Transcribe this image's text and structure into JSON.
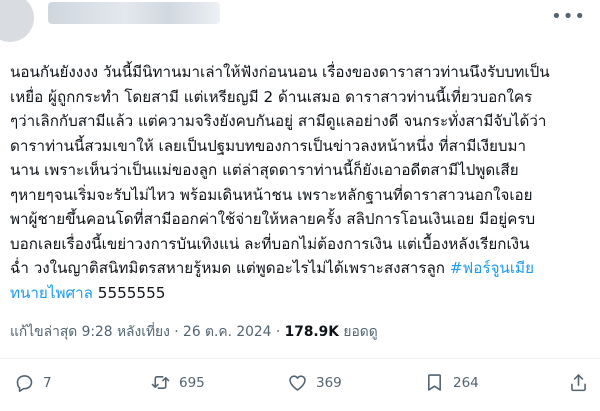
{
  "tweet": {
    "lines": [
      "นอนกันยังงงง วันนี้มีนิทานมาเล่าให้ฟังก่อนนอน เรื่องของดาราสาวท่านนึงรับบทเป็น",
      "เหยื่อ ผู้ถูกกระทำ โดยสามี แต่เหรียญมี 2 ด้านเสมอ ดาราสาวท่านนี้เที่ยวบอกใคร",
      "ๆว่าเลิกกับสามีแล้ว แต่ความจริงยังคบกันอยู่ สามีดูแลอย่างดี จนกระทั่งสามีจับได้ว่า",
      "ดาราท่านนี้สวมเขาให้ เลยเป็นปฐมบทของการเป็นข่าวลงหน้าหนึ่ง ที่สามีเงียบมา",
      "นาน เพราะเห็นว่าเป็นแม่ของลูก แต่ล่าสุดดาราท่านนี้ก็ยังเอาอดีตสามีไปพูดเสีย",
      "ๆหายๆจนเริ่มจะรับไม่ไหว พร้อมเดินหน้าชน เพราะหลักฐานที่ดาราสาวนอกใจเอย",
      "พาผู้ชายขึ้นคอนโดที่สามีออกค่าใช้จ่ายให้หลายครั้ง สลิปการโอนเงินเอย มีอยู่ครบ",
      "บอกเลยเรื่องนี้เขย่าวงการบันเทิงแน่ ละที่บอกไม่ต้องการเงิน แต่เบื้องหลังเรียกเงิน",
      "ฉ่ำ วงในญาติสนิทมิตรสหายรู้หมด แต่พูดอะไรไม่ได้เพราะสงสารลูก"
    ],
    "hashtag_part1": "#ฟอร์จูนเมีย",
    "hashtag_part2": "ทนายไพศาล",
    "trailing_text": "5555555"
  },
  "meta": {
    "time": "แก้ไขล่าสุด 9:28 หลังเที่ยง",
    "dot": "·",
    "date": "26 ต.ค. 2024",
    "views_count": "178.9K",
    "views_label": "ยอดดู"
  },
  "actions": {
    "reply_count": "7",
    "retweet_count": "695",
    "like_count": "369",
    "bookmark_count": "264"
  },
  "icons": {
    "more": "more-dots-icon",
    "reply": "reply-icon",
    "retweet": "retweet-icon",
    "like": "heart-icon",
    "bookmark": "bookmark-icon",
    "share": "share-icon"
  },
  "colors": {
    "accent": "#1d9bf0",
    "muted": "#536471",
    "text": "#0f1419"
  }
}
